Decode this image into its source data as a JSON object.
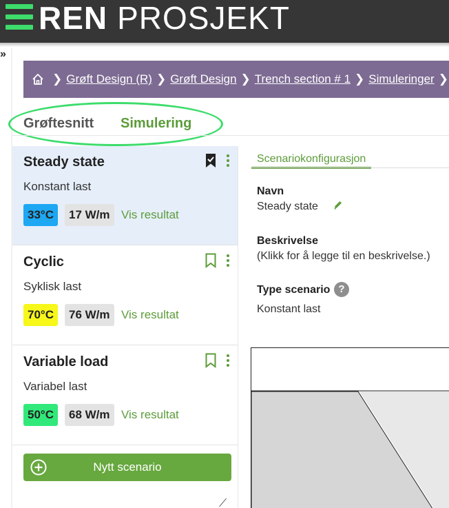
{
  "header": {
    "brand_bold": "REN",
    "brand_light": "PROSJEKT"
  },
  "sidebar_toggle": "»",
  "breadcrumb": {
    "items": [
      {
        "label": "Grøft Design (R)"
      },
      {
        "label": "Grøft Design"
      },
      {
        "label": "Trench section # 1"
      },
      {
        "label": "Simuleringer"
      }
    ]
  },
  "tabs": [
    {
      "label": "Grøftesnitt",
      "active": false
    },
    {
      "label": "Simulering",
      "active": true
    }
  ],
  "scenarios": [
    {
      "title": "Steady state",
      "subtitle": "Konstant last",
      "temperature": "33°C",
      "temp_color": "#1ea7f2",
      "load": "17 W/m",
      "result_link": "Vis resultat",
      "bookmarked": true,
      "active": true
    },
    {
      "title": "Cyclic",
      "subtitle": "Syklisk last",
      "temperature": "70°C",
      "temp_color": "#f7f71a",
      "load": "76 W/m",
      "result_link": "Vis resultat",
      "bookmarked": false,
      "active": false
    },
    {
      "title": "Variable load",
      "subtitle": "Variabel last",
      "temperature": "50°C",
      "temp_color": "#31e97a",
      "load": "68 W/m",
      "result_link": "Vis resultat",
      "bookmarked": false,
      "active": false
    }
  ],
  "new_scenario_button": "Nytt scenario",
  "config": {
    "tab_label": "Scenariokonfigurasjon",
    "name_label": "Navn",
    "name_value": "Steady state",
    "description_label": "Beskrivelse",
    "description_value": "(Klikk for å legge til en beskrivelse.)",
    "type_label": "Type scenario",
    "type_help": "?",
    "type_value": "Konstant last"
  },
  "colors": {
    "accent_green": "#5c9c3a",
    "button_green": "#67a83f",
    "highlight_ellipse": "#3ddc6b",
    "breadcrumb_bg": "#7d6b93",
    "header_bg": "#363636",
    "active_row_bg": "#e6eefa"
  },
  "icons": {
    "home": "home-icon",
    "separator": "chevron-right-icon",
    "bookmark": "bookmark-icon",
    "menu": "more-vertical-icon",
    "edit": "pencil-icon",
    "add": "plus-circle-icon"
  }
}
